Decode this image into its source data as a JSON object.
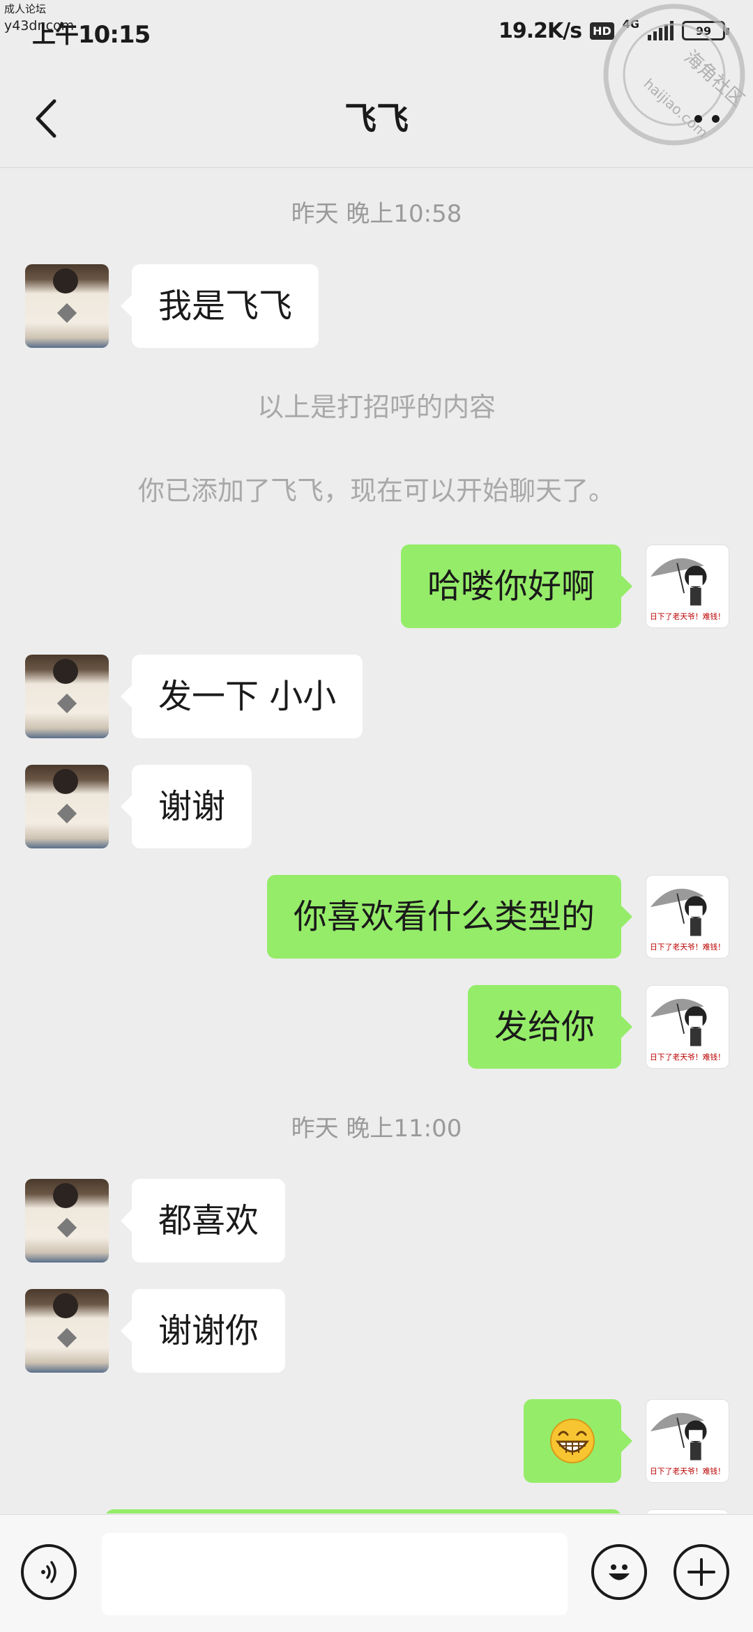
{
  "status_bar": {
    "time": "上午10:15",
    "net_speed": "19.2K/s",
    "hd": "HD",
    "net_type": "4G",
    "battery": "99"
  },
  "watermarks": {
    "site_name": "成人论坛",
    "site_domain": "y43dr.com",
    "stamp_text": "海角社区",
    "stamp_domain": "haijiao.com"
  },
  "header": {
    "title": "飞飞"
  },
  "chat": {
    "timestamp_1": "昨天 晚上10:58",
    "msg_1": "我是飞飞",
    "system_1": "以上是打招呼的内容",
    "system_2": "你已添加了飞飞，现在可以开始聊天了。",
    "msg_2": "哈喽你好啊",
    "msg_3": "发一下 小小",
    "msg_4": "谢谢",
    "msg_5": "你喜欢看什么类型的",
    "msg_6": "发给你",
    "timestamp_2": "昨天 晚上11:00",
    "msg_7": "都喜欢",
    "msg_8": "谢谢你",
    "msg_9_emoji": "grin-emoji",
    "sticker_caption": "日下了老天爷！难钱！"
  },
  "input": {
    "placeholder": ""
  },
  "colors": {
    "background": "#ededed",
    "outgoing_bubble": "#95ec69",
    "incoming_bubble": "#ffffff",
    "timestamp_text": "#9a9a9a"
  }
}
